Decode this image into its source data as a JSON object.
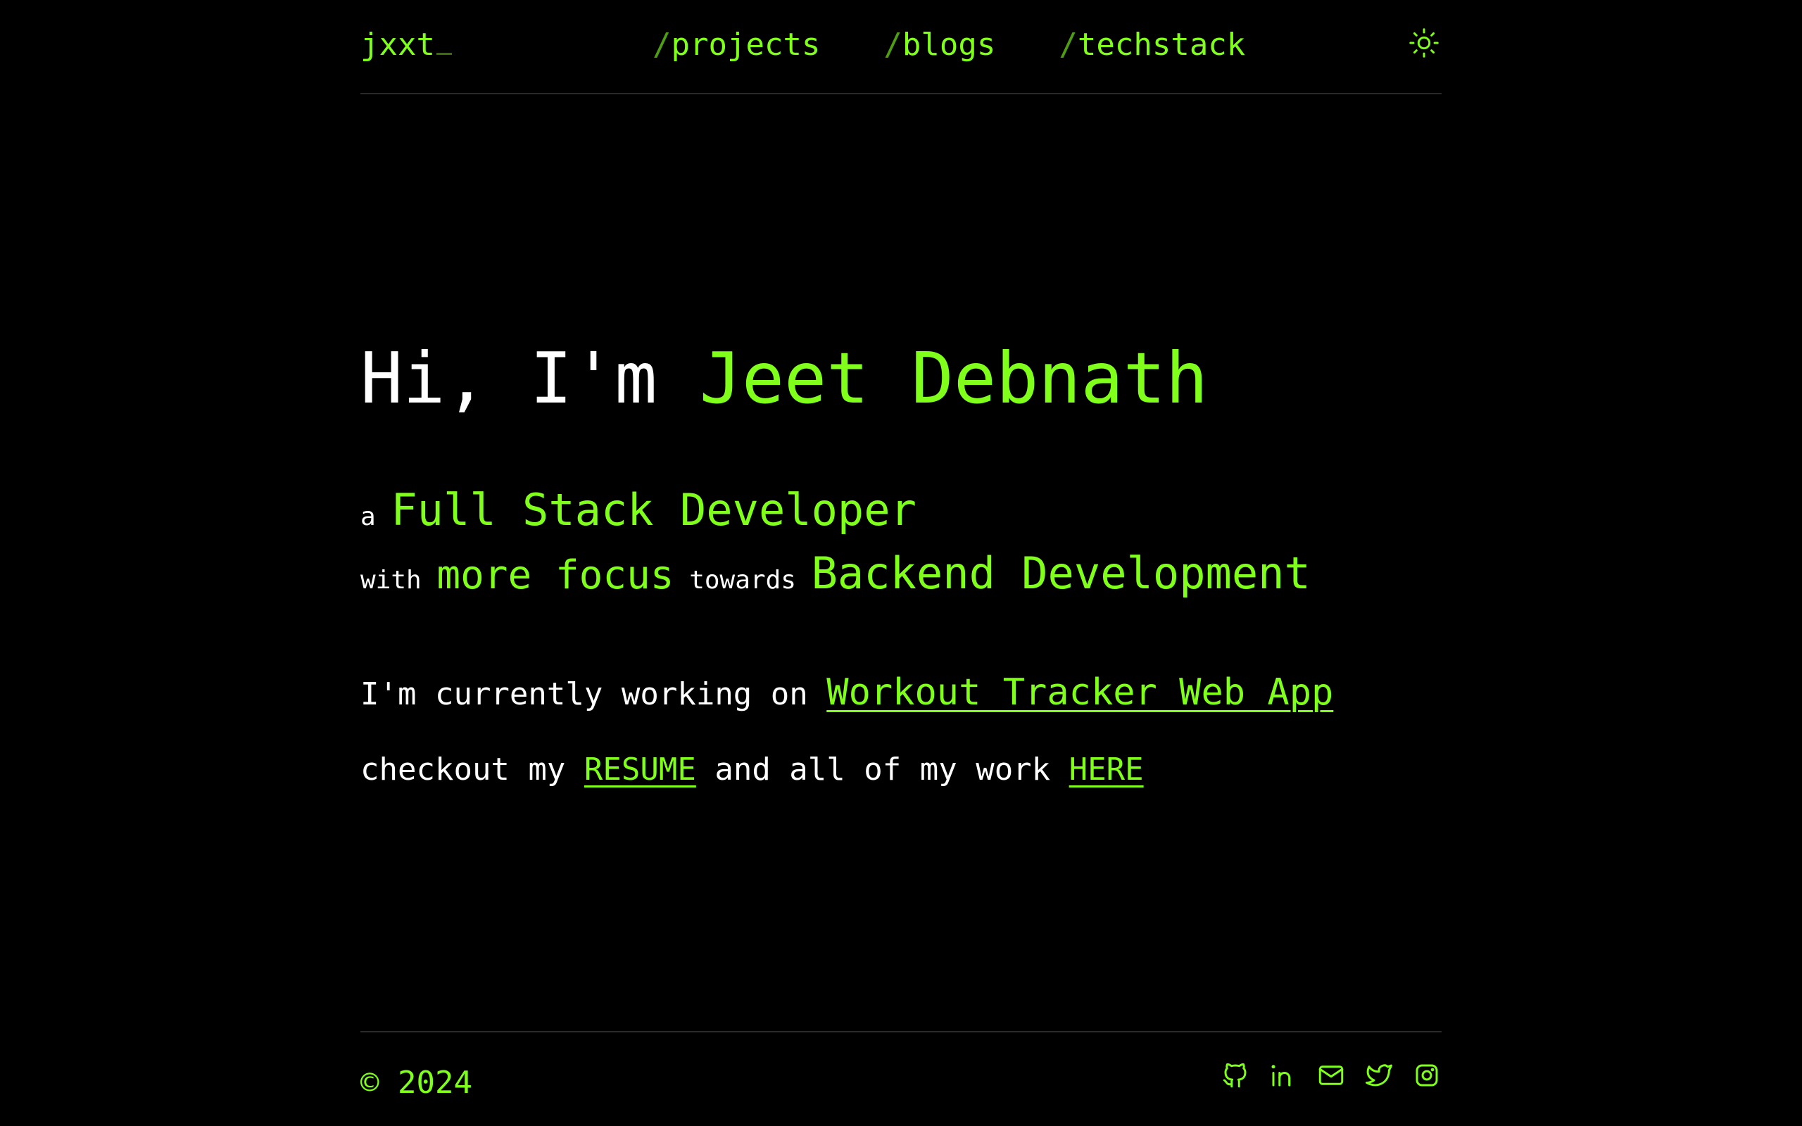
{
  "header": {
    "logo": "jxxt",
    "nav": [
      {
        "slash": "/",
        "label": "projects"
      },
      {
        "slash": "/",
        "label": "blogs"
      },
      {
        "slash": "/",
        "label": "techstack"
      }
    ],
    "theme_icon": "sun-icon"
  },
  "hero": {
    "greeting": "Hi, I'm ",
    "name": "Jeet Debnath",
    "role_prefix": "a ",
    "role": "Full Stack Developer",
    "with": "with ",
    "focus": "more focus",
    "towards": " towards ",
    "specialty": "Backend Development"
  },
  "working": {
    "prefix": "I'm currently working on ",
    "project": "Workout Tracker Web App"
  },
  "resume_line": {
    "prefix": "checkout my ",
    "resume": "RESUME",
    "middle": " and all of my work ",
    "here": "HERE"
  },
  "footer": {
    "copyright": "© 2024",
    "socials": [
      "github-icon",
      "linkedin-icon",
      "mail-icon",
      "twitter-icon",
      "instagram-icon"
    ]
  },
  "colors": {
    "accent": "#7fff1a",
    "background": "#000000",
    "text": "#ffffff"
  }
}
